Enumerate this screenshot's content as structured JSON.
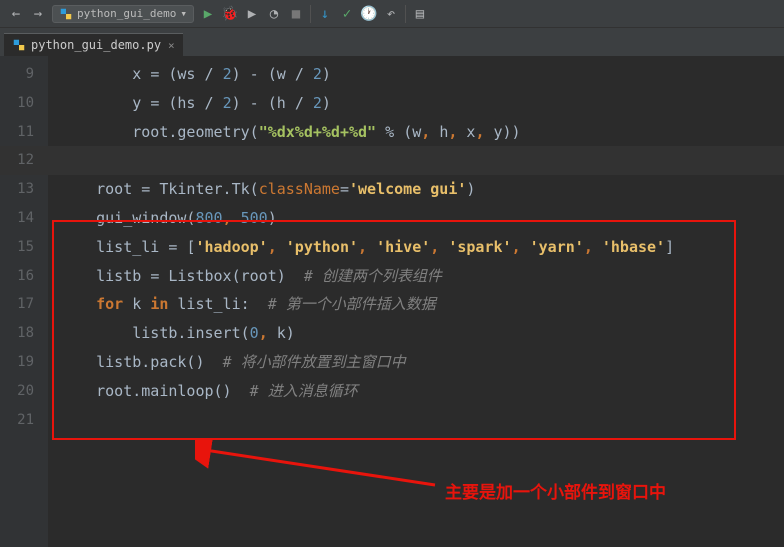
{
  "toolbar": {
    "run_config": "python_gui_demo"
  },
  "tab": {
    "filename": "python_gui_demo.py"
  },
  "gutter": {
    "lines": [
      "9",
      "10",
      "11",
      "12",
      "13",
      "14",
      "15",
      "16",
      "17",
      "18",
      "19",
      "20",
      "21"
    ]
  },
  "code": {
    "l9_a": "        x ",
    "l9_b": "= ",
    "l9_c": "(ws ",
    "l9_d": "/ ",
    "l9_e": "2",
    "l9_f": ") ",
    "l9_g": "- ",
    "l9_h": "(w ",
    "l9_i": "/ ",
    "l9_j": "2",
    "l9_k": ")",
    "l10_a": "        y ",
    "l10_b": "= ",
    "l10_c": "(hs ",
    "l10_d": "/ ",
    "l10_e": "2",
    "l10_f": ") ",
    "l10_g": "- ",
    "l10_h": "(h ",
    "l10_i": "/ ",
    "l10_j": "2",
    "l10_k": ")",
    "l11_a": "        root.geometry(",
    "l11_b": "\"%dx%d+%d+%d\"",
    "l11_c": " % ",
    "l11_d": "(w",
    "l11_e": ", ",
    "l11_f": "h",
    "l11_g": ", ",
    "l11_h": "x",
    "l11_i": ", ",
    "l11_j": "y))",
    "l13_a": "    root ",
    "l13_b": "= ",
    "l13_c": "Tkinter.Tk(",
    "l13_d": "className",
    "l13_e": "=",
    "l13_f": "'welcome gui'",
    "l13_g": ")",
    "l14_a": "    gui_window(",
    "l14_b": "800",
    "l14_c": ", ",
    "l14_d": "500",
    "l14_e": ")",
    "l15_a": "    list_li ",
    "l15_b": "= ",
    "l15_c": "[",
    "l15_d": "'hadoop'",
    "l15_e": ", ",
    "l15_f": "'python'",
    "l15_g": ", ",
    "l15_h": "'hive'",
    "l15_i": ", ",
    "l15_j": "'spark'",
    "l15_k": ", ",
    "l15_l": "'yarn'",
    "l15_m": ", ",
    "l15_n": "'hbase'",
    "l15_o": "]",
    "l16_a": "    listb ",
    "l16_b": "= ",
    "l16_c": "Listbox(root)  ",
    "l16_d": "# 创建两个列表组件",
    "l17_a": "    ",
    "l17_b": "for ",
    "l17_c": "k ",
    "l17_d": "in ",
    "l17_e": "list_li:  ",
    "l17_f": "# 第一个小部件插入数据",
    "l18_a": "        listb.insert(",
    "l18_b": "0",
    "l18_c": ", ",
    "l18_d": "k)",
    "l19_a": "    listb.pack()  ",
    "l19_b": "# 将小部件放置到主窗口中",
    "l20_a": "    root.mainloop()  ",
    "l20_b": "# 进入消息循环"
  },
  "annotation": {
    "text": "主要是加一个小部件到窗口中"
  }
}
